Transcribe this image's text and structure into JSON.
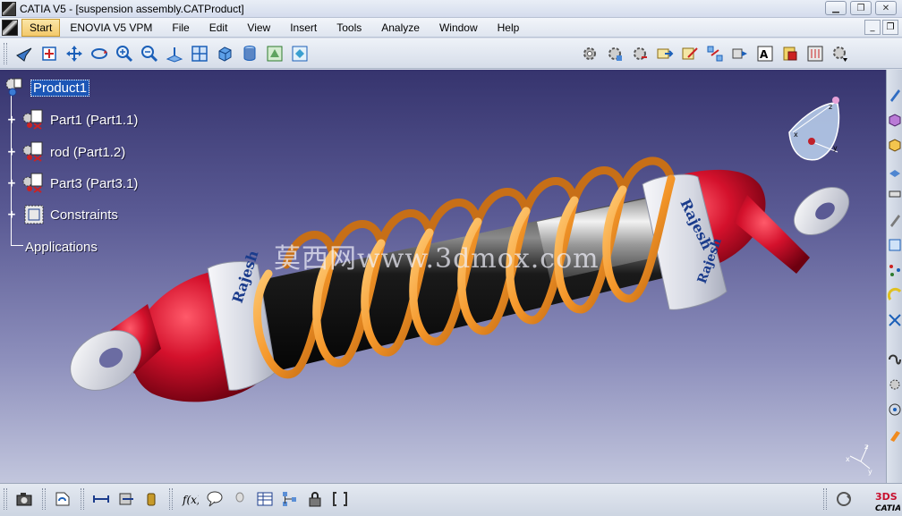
{
  "window": {
    "title": "CATIA V5 - [suspension assembly.CATProduct]",
    "controls": [
      "minimize-icon",
      "restore-icon",
      "close-icon"
    ]
  },
  "menu": {
    "items": [
      {
        "label": "Start"
      },
      {
        "label": "ENOVIA V5 VPM"
      },
      {
        "label": "File"
      },
      {
        "label": "Edit"
      },
      {
        "label": "View"
      },
      {
        "label": "Insert"
      },
      {
        "label": "Tools"
      },
      {
        "label": "Analyze"
      },
      {
        "label": "Window"
      },
      {
        "label": "Help"
      }
    ]
  },
  "tree": {
    "root": "Product1",
    "nodes": [
      {
        "label": "Part1 (Part1.1)"
      },
      {
        "label": "rod (Part1.2)"
      },
      {
        "label": "Part3 (Part3.1)"
      },
      {
        "label": "Constraints"
      },
      {
        "label": "Applications"
      }
    ]
  },
  "model": {
    "brand_text_left": "Rajesh",
    "brand_text_right": "Rajesh",
    "colors": {
      "spring": "#f5972a",
      "cap": "#c8102e",
      "rod": "#151515",
      "eye": "#e4e6ee",
      "background_top": "#36346e",
      "background_bottom": "#c2c6dd"
    }
  },
  "watermark": "莫西网www.3dmox.com",
  "compass": {
    "axes": [
      "x",
      "y",
      "z"
    ]
  },
  "axis_triad": {
    "labels": [
      "x",
      "y",
      "z"
    ]
  },
  "logo": {
    "text": "CATIA",
    "mark": "3DS"
  }
}
